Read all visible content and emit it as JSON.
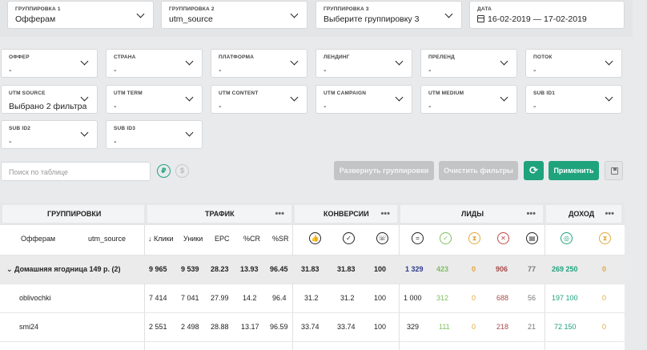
{
  "groupings": [
    {
      "label": "ГРУППИРОВКА 1",
      "value": "Офферам"
    },
    {
      "label": "ГРУППИРОВКА 2",
      "value": "utm_source"
    },
    {
      "label": "ГРУППИРОВКА 3",
      "value": "Выберите группировку 3"
    }
  ],
  "date": {
    "label": "ДАТА",
    "value": "16-02-2019 — 17-02-2019"
  },
  "filters": [
    {
      "label": "ОФФЕР",
      "value": "-"
    },
    {
      "label": "СТРАНА",
      "value": "-"
    },
    {
      "label": "ПЛАТФОРМА",
      "value": "-"
    },
    {
      "label": "ЛЕНДИНГ",
      "value": "-"
    },
    {
      "label": "ПРЕЛЕНД",
      "value": "-"
    },
    {
      "label": "ПОТОК",
      "value": "-"
    },
    {
      "label": "UTM SOURCE",
      "value": "Выбрано 2 фильтра"
    },
    {
      "label": "UTM TERM",
      "value": "-"
    },
    {
      "label": "UTM CONTENT",
      "value": "-"
    },
    {
      "label": "UTM CAMPAIGN",
      "value": "-"
    },
    {
      "label": "UTM MEDIUM",
      "value": "-"
    },
    {
      "label": "SUB ID1",
      "value": "-"
    },
    {
      "label": "SUB ID2",
      "value": "-"
    },
    {
      "label": "SUB ID3",
      "value": "-"
    }
  ],
  "search": {
    "placeholder": "Поиск по таблице"
  },
  "currency": {
    "rub": "₽",
    "usd": "$"
  },
  "buttons": {
    "expand": "Развернуть группировки",
    "clear": "Очистить фильтры",
    "refresh": "⟳",
    "apply": "Применить"
  },
  "table": {
    "groups": {
      "groupings": "ГРУППИРОВКИ",
      "traffic": "ТРАФИК",
      "conversions": "КОНВЕРСИИ",
      "leads": "ЛИДЫ",
      "income": "ДОХОД",
      "more": "•••"
    },
    "subheaders": {
      "col1": "Офферам",
      "col2": "utm_source",
      "clicks": "↓ Клики",
      "uniques": "Уники",
      "epc": "EPC",
      "cr": "%CR",
      "sr": "%SR"
    },
    "icons": {
      "like": "👍",
      "check": "✓",
      "phone": "☏",
      "equal": "=",
      "check2": "✓",
      "hourglass": "⧗",
      "cross": "✕",
      "trash": "▤",
      "coins": "◎",
      "hourglass2": "⧗"
    },
    "rows": [
      {
        "name": "⌄ Домашняя ягодница 149 р. (2)",
        "clicks": "9 965",
        "uniques": "9 539",
        "epc": "28.23",
        "cr": "13.93",
        "sr": "96.45",
        "conv1": "31.83",
        "conv2": "31.83",
        "conv3": "100",
        "leads_total": "1 329",
        "leads_ok": "423",
        "leads_hold": "0",
        "leads_rej": "906",
        "leads_trash": "77",
        "income": "269 250",
        "income_hold": "0"
      },
      {
        "name": "oblivochki",
        "clicks": "7 414",
        "uniques": "7 041",
        "epc": "27.99",
        "cr": "14.2",
        "sr": "96.4",
        "conv1": "31.2",
        "conv2": "31.2",
        "conv3": "100",
        "leads_total": "1 000",
        "leads_ok": "312",
        "leads_hold": "0",
        "leads_rej": "688",
        "leads_trash": "56",
        "income": "197 100",
        "income_hold": "0"
      },
      {
        "name": "smi24",
        "clicks": "2 551",
        "uniques": "2 498",
        "epc": "28.88",
        "cr": "13.17",
        "sr": "96.59",
        "conv1": "33.74",
        "conv2": "33.74",
        "conv3": "100",
        "leads_total": "329",
        "leads_ok": "111",
        "leads_hold": "0",
        "leads_rej": "218",
        "leads_trash": "21",
        "income": "72 150",
        "income_hold": "0"
      }
    ]
  }
}
